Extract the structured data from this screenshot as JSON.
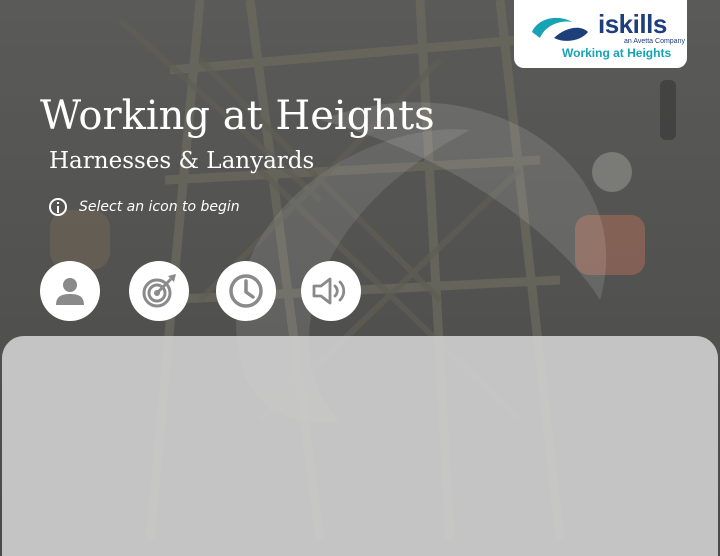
{
  "header": {
    "title": "Working at Heights",
    "subtitle": "Harnesses & Lanyards"
  },
  "instruction": {
    "text": "Select an icon to begin",
    "icon": "info-icon"
  },
  "logo": {
    "brand": "iskills",
    "tagline": "an Avetta Company",
    "course": "Working at Heights"
  },
  "menu": {
    "buttons": [
      {
        "icon": "person-icon"
      },
      {
        "icon": "target-icon"
      },
      {
        "icon": "clock-icon"
      },
      {
        "icon": "speaker-icon"
      }
    ]
  },
  "colors": {
    "overlay": "#4a4a4a",
    "panel": "#cdcdcd",
    "icon": "#8a8a8a",
    "brand_navy": "#1f3f7a",
    "brand_teal": "#16a3b5",
    "text": "#ffffff"
  }
}
